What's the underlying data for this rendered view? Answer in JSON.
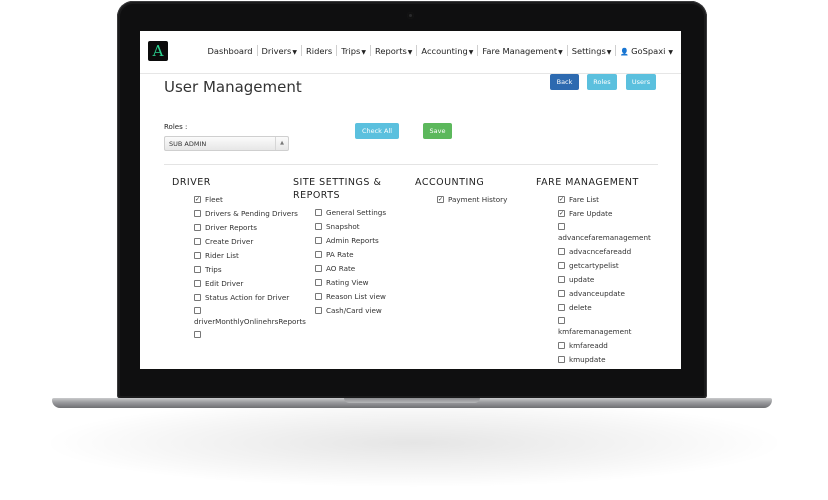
{
  "nav": {
    "logo": "A",
    "items": [
      {
        "label": "Dashboard",
        "caret": false
      },
      {
        "label": "Drivers",
        "caret": true
      },
      {
        "label": "Riders",
        "caret": false
      },
      {
        "label": "Trips",
        "caret": true
      },
      {
        "label": "Reports",
        "caret": true
      },
      {
        "label": "Accounting",
        "caret": true
      },
      {
        "label": "Fare Management",
        "caret": true
      },
      {
        "label": "Settings",
        "caret": true
      }
    ],
    "user": "GoSpaxi"
  },
  "page": {
    "title": "User Management"
  },
  "buttons": {
    "back": "Back",
    "roles": "Roles",
    "users": "Users",
    "check_all": "Check All",
    "save": "Save"
  },
  "roles": {
    "label": "Roles :",
    "selected": "SUB ADMIN"
  },
  "columns": [
    {
      "heading": "DRIVER",
      "perms": [
        {
          "label": "Fleet",
          "checked": true
        },
        {
          "label": "Drivers & Pending Drivers",
          "checked": false
        },
        {
          "label": "Driver Reports",
          "checked": false
        },
        {
          "label": "Create Driver",
          "checked": false
        },
        {
          "label": "Rider List",
          "checked": false
        },
        {
          "label": "Trips",
          "checked": false
        },
        {
          "label": "Edit Driver",
          "checked": false
        },
        {
          "label": "Status Action for Driver",
          "checked": false
        },
        {
          "label": "driverMonthlyOnlinehrsReports",
          "checked": false,
          "stack": true
        },
        {
          "label": "",
          "checked": false,
          "stack": true
        }
      ]
    },
    {
      "heading": "SITE SETTINGS & REPORTS",
      "perms": [
        {
          "label": "General Settings",
          "checked": false
        },
        {
          "label": "Snapshot",
          "checked": false
        },
        {
          "label": "Admin Reports",
          "checked": false
        },
        {
          "label": "PA Rate",
          "checked": false
        },
        {
          "label": "AO Rate",
          "checked": false
        },
        {
          "label": "Rating View",
          "checked": false
        },
        {
          "label": "Reason List view",
          "checked": false
        },
        {
          "label": "Cash/Card view",
          "checked": false
        }
      ]
    },
    {
      "heading": "ACCOUNTING",
      "perms": [
        {
          "label": "Payment History",
          "checked": true
        }
      ]
    },
    {
      "heading": "FARE MANAGEMENT",
      "perms": [
        {
          "label": "Fare List",
          "checked": true
        },
        {
          "label": "Fare Update",
          "checked": true
        },
        {
          "label": "advancefaremanagement",
          "checked": false,
          "stack": true
        },
        {
          "label": "advacncefareadd",
          "checked": false
        },
        {
          "label": "getcartypelist",
          "checked": false
        },
        {
          "label": "update",
          "checked": false
        },
        {
          "label": "advanceupdate",
          "checked": false
        },
        {
          "label": "delete",
          "checked": false
        },
        {
          "label": "kmfaremanagement",
          "checked": false,
          "stack": true
        },
        {
          "label": "kmfareadd",
          "checked": false
        },
        {
          "label": "kmupdate",
          "checked": false
        }
      ]
    }
  ]
}
